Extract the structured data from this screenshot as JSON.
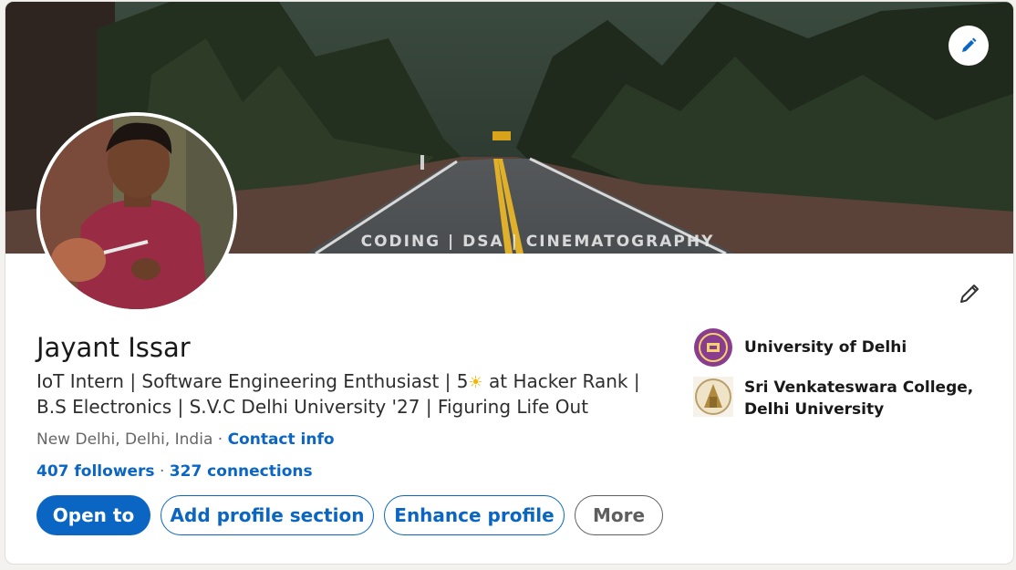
{
  "banner": {
    "text": "CODING | DSA | CINEMATOGRAPHY"
  },
  "profile": {
    "name": "Jayant Issar",
    "headline_part1": "IoT Intern | Software Engineering Enthusiast | 5",
    "headline_emoji": "☀",
    "headline_part2": " at Hacker Rank | B.S Electronics | S.V.C Delhi University '27 | Figuring Life Out",
    "location": "New Delhi, Delhi, India",
    "separator": " · ",
    "contact_info": "Contact info",
    "followers": "407 followers",
    "network_separator": " · ",
    "connections": "327 connections"
  },
  "actions": {
    "open_to": "Open to",
    "add_profile_section": "Add profile section",
    "enhance_profile": "Enhance profile",
    "more": "More"
  },
  "education": [
    {
      "name": "University of Delhi",
      "logo": "university-of-delhi-logo"
    },
    {
      "name": "Sri Venkateswara College, Delhi University",
      "logo": "sri-venkateswara-college-logo"
    }
  ],
  "colors": {
    "brand_blue": "#0a66c2",
    "text_primary": "#191919",
    "text_secondary": "#666666"
  },
  "icons": {
    "banner_edit": "pencil-icon",
    "intro_edit": "pencil-icon"
  }
}
